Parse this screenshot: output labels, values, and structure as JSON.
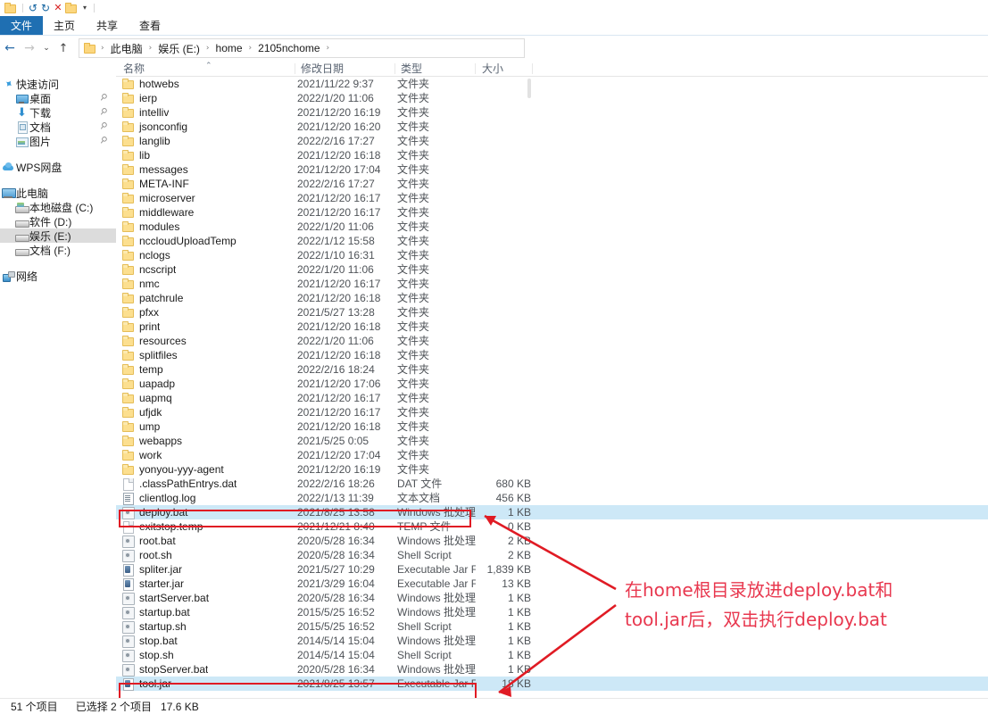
{
  "titlebar": {
    "icons": [
      "folder-icon",
      "undo-icon",
      "redo-icon",
      "delete-icon",
      "folder-properties-icon",
      "customize-toolbar-caret"
    ],
    "undo_glyph": "↺",
    "redo_glyph": "↻",
    "delete_glyph": "✕",
    "caret_glyph": "▾"
  },
  "ribbon": {
    "tabs": [
      {
        "label": "文件",
        "active": true
      },
      {
        "label": "主页",
        "active": false
      },
      {
        "label": "共享",
        "active": false
      },
      {
        "label": "查看",
        "active": false
      }
    ]
  },
  "addressbar": {
    "back_glyph": "←",
    "forward_glyph": "→",
    "recent_glyph": "⌄",
    "up_glyph": "↑",
    "crumbs": [
      "此电脑",
      "娱乐 (E:)",
      "home",
      "2105nchome"
    ],
    "separator": "›"
  },
  "sidebar": {
    "items": [
      {
        "label": "快速访问",
        "icon": "star-pin-icon",
        "level": "group",
        "pinned": false,
        "selected": false
      },
      {
        "label": "桌面",
        "icon": "desktop-icon",
        "level": "child",
        "pinned": true,
        "selected": false
      },
      {
        "label": "下载",
        "icon": "downloads-icon",
        "level": "child",
        "pinned": true,
        "selected": false
      },
      {
        "label": "文档",
        "icon": "documents-icon",
        "level": "child",
        "pinned": true,
        "selected": false
      },
      {
        "label": "图片",
        "icon": "pictures-icon",
        "level": "child",
        "pinned": true,
        "selected": false
      },
      {
        "label": "WPS网盘",
        "icon": "cloud-icon",
        "level": "group",
        "pinned": false,
        "selected": false
      },
      {
        "label": "此电脑",
        "icon": "this-pc-icon",
        "level": "group",
        "pinned": false,
        "selected": false
      },
      {
        "label": "本地磁盘 (C:)",
        "icon": "system-drive-icon",
        "level": "child",
        "pinned": false,
        "selected": false
      },
      {
        "label": "软件 (D:)",
        "icon": "drive-icon",
        "level": "child",
        "pinned": false,
        "selected": false
      },
      {
        "label": "娱乐 (E:)",
        "icon": "drive-icon",
        "level": "child",
        "pinned": false,
        "selected": true
      },
      {
        "label": "文档 (F:)",
        "icon": "drive-icon",
        "level": "child",
        "pinned": false,
        "selected": false
      },
      {
        "label": "网络",
        "icon": "network-icon",
        "level": "group",
        "pinned": false,
        "selected": false
      }
    ]
  },
  "filelist": {
    "columns": [
      {
        "label": "名称",
        "sorted": "asc",
        "sort_glyph": "⌃"
      },
      {
        "label": "修改日期",
        "sorted": ""
      },
      {
        "label": "类型",
        "sorted": ""
      },
      {
        "label": "大小",
        "sorted": ""
      }
    ],
    "rows": [
      {
        "name": "hotwebs",
        "date": "2021/11/22 9:37",
        "type": "文件夹",
        "size": "",
        "icon": "folder-icon",
        "selected": false
      },
      {
        "name": "ierp",
        "date": "2022/1/20 11:06",
        "type": "文件夹",
        "size": "",
        "icon": "folder-icon",
        "selected": false
      },
      {
        "name": "intelliv",
        "date": "2021/12/20 16:19",
        "type": "文件夹",
        "size": "",
        "icon": "folder-icon",
        "selected": false
      },
      {
        "name": "jsonconfig",
        "date": "2021/12/20 16:20",
        "type": "文件夹",
        "size": "",
        "icon": "folder-icon",
        "selected": false
      },
      {
        "name": "langlib",
        "date": "2022/2/16 17:27",
        "type": "文件夹",
        "size": "",
        "icon": "folder-icon",
        "selected": false
      },
      {
        "name": "lib",
        "date": "2021/12/20 16:18",
        "type": "文件夹",
        "size": "",
        "icon": "folder-icon",
        "selected": false
      },
      {
        "name": "messages",
        "date": "2021/12/20 17:04",
        "type": "文件夹",
        "size": "",
        "icon": "folder-icon",
        "selected": false
      },
      {
        "name": "META-INF",
        "date": "2022/2/16 17:27",
        "type": "文件夹",
        "size": "",
        "icon": "folder-icon",
        "selected": false
      },
      {
        "name": "microserver",
        "date": "2021/12/20 16:17",
        "type": "文件夹",
        "size": "",
        "icon": "folder-icon",
        "selected": false
      },
      {
        "name": "middleware",
        "date": "2021/12/20 16:17",
        "type": "文件夹",
        "size": "",
        "icon": "folder-icon",
        "selected": false
      },
      {
        "name": "modules",
        "date": "2022/1/20 11:06",
        "type": "文件夹",
        "size": "",
        "icon": "folder-icon",
        "selected": false
      },
      {
        "name": "nccloudUploadTemp",
        "date": "2022/1/12 15:58",
        "type": "文件夹",
        "size": "",
        "icon": "folder-icon",
        "selected": false
      },
      {
        "name": "nclogs",
        "date": "2022/1/10 16:31",
        "type": "文件夹",
        "size": "",
        "icon": "folder-icon",
        "selected": false
      },
      {
        "name": "ncscript",
        "date": "2022/1/20 11:06",
        "type": "文件夹",
        "size": "",
        "icon": "folder-icon",
        "selected": false
      },
      {
        "name": "nmc",
        "date": "2021/12/20 16:17",
        "type": "文件夹",
        "size": "",
        "icon": "folder-icon",
        "selected": false
      },
      {
        "name": "patchrule",
        "date": "2021/12/20 16:18",
        "type": "文件夹",
        "size": "",
        "icon": "folder-icon",
        "selected": false
      },
      {
        "name": "pfxx",
        "date": "2021/5/27 13:28",
        "type": "文件夹",
        "size": "",
        "icon": "folder-icon",
        "selected": false
      },
      {
        "name": "print",
        "date": "2021/12/20 16:18",
        "type": "文件夹",
        "size": "",
        "icon": "folder-icon",
        "selected": false
      },
      {
        "name": "resources",
        "date": "2022/1/20 11:06",
        "type": "文件夹",
        "size": "",
        "icon": "folder-icon",
        "selected": false
      },
      {
        "name": "splitfiles",
        "date": "2021/12/20 16:18",
        "type": "文件夹",
        "size": "",
        "icon": "folder-icon",
        "selected": false
      },
      {
        "name": "temp",
        "date": "2022/2/16 18:24",
        "type": "文件夹",
        "size": "",
        "icon": "folder-icon",
        "selected": false
      },
      {
        "name": "uapadp",
        "date": "2021/12/20 17:06",
        "type": "文件夹",
        "size": "",
        "icon": "folder-icon",
        "selected": false
      },
      {
        "name": "uapmq",
        "date": "2021/12/20 16:17",
        "type": "文件夹",
        "size": "",
        "icon": "folder-icon",
        "selected": false
      },
      {
        "name": "ufjdk",
        "date": "2021/12/20 16:17",
        "type": "文件夹",
        "size": "",
        "icon": "folder-icon",
        "selected": false
      },
      {
        "name": "ump",
        "date": "2021/12/20 16:18",
        "type": "文件夹",
        "size": "",
        "icon": "folder-icon",
        "selected": false
      },
      {
        "name": "webapps",
        "date": "2021/5/25 0:05",
        "type": "文件夹",
        "size": "",
        "icon": "folder-icon",
        "selected": false
      },
      {
        "name": "work",
        "date": "2021/12/20 17:04",
        "type": "文件夹",
        "size": "",
        "icon": "folder-icon",
        "selected": false
      },
      {
        "name": "yonyou-yyy-agent",
        "date": "2021/12/20 16:19",
        "type": "文件夹",
        "size": "",
        "icon": "folder-icon",
        "selected": false
      },
      {
        "name": ".classPathEntrys.dat",
        "date": "2022/2/16 18:26",
        "type": "DAT 文件",
        "size": "680 KB",
        "icon": "dat-file-icon",
        "selected": false
      },
      {
        "name": "clientlog.log",
        "date": "2022/1/13 11:39",
        "type": "文本文档",
        "size": "456 KB",
        "icon": "text-file-icon",
        "selected": false
      },
      {
        "name": "deploy.bat",
        "date": "2021/8/25 13:58",
        "type": "Windows 批处理...",
        "size": "1 KB",
        "icon": "bat-file-icon",
        "selected": true
      },
      {
        "name": "exitstop.temp",
        "date": "2021/12/21 8:40",
        "type": "TEMP 文件",
        "size": "0 KB",
        "icon": "dat-file-icon",
        "selected": false
      },
      {
        "name": "root.bat",
        "date": "2020/5/28 16:34",
        "type": "Windows 批处理...",
        "size": "2 KB",
        "icon": "bat-file-icon",
        "selected": false
      },
      {
        "name": "root.sh",
        "date": "2020/5/28 16:34",
        "type": "Shell Script",
        "size": "2 KB",
        "icon": "bat-file-icon",
        "selected": false
      },
      {
        "name": "spliter.jar",
        "date": "2021/5/27 10:29",
        "type": "Executable Jar File",
        "size": "1,839 KB",
        "icon": "jar-file-icon",
        "selected": false
      },
      {
        "name": "starter.jar",
        "date": "2021/3/29 16:04",
        "type": "Executable Jar File",
        "size": "13 KB",
        "icon": "jar-file-icon",
        "selected": false
      },
      {
        "name": "startServer.bat",
        "date": "2020/5/28 16:34",
        "type": "Windows 批处理...",
        "size": "1 KB",
        "icon": "bat-file-icon",
        "selected": false
      },
      {
        "name": "startup.bat",
        "date": "2015/5/25 16:52",
        "type": "Windows 批处理...",
        "size": "1 KB",
        "icon": "bat-file-icon",
        "selected": false
      },
      {
        "name": "startup.sh",
        "date": "2015/5/25 16:52",
        "type": "Shell Script",
        "size": "1 KB",
        "icon": "bat-file-icon",
        "selected": false
      },
      {
        "name": "stop.bat",
        "date": "2014/5/14 15:04",
        "type": "Windows 批处理...",
        "size": "1 KB",
        "icon": "bat-file-icon",
        "selected": false
      },
      {
        "name": "stop.sh",
        "date": "2014/5/14 15:04",
        "type": "Shell Script",
        "size": "1 KB",
        "icon": "bat-file-icon",
        "selected": false
      },
      {
        "name": "stopServer.bat",
        "date": "2020/5/28 16:34",
        "type": "Windows 批处理...",
        "size": "1 KB",
        "icon": "bat-file-icon",
        "selected": false
      },
      {
        "name": "tool.jar",
        "date": "2021/8/25 13:57",
        "type": "Executable Jar File",
        "size": "18 KB",
        "icon": "jar-file-icon",
        "selected": true
      }
    ]
  },
  "annotations": {
    "color": "#e8384f",
    "box_color": "#e01b24",
    "text_line1": "在home根目录放进deploy.bat和",
    "text_line2": "tool.jar后，双击执行deploy.bat",
    "highlight_targets": [
      "deploy.bat",
      "tool.jar"
    ]
  },
  "statusbar": {
    "item_count": "51 个项目",
    "selected_label": "已选择 2 个项目",
    "selected_size": "17.6 KB"
  }
}
